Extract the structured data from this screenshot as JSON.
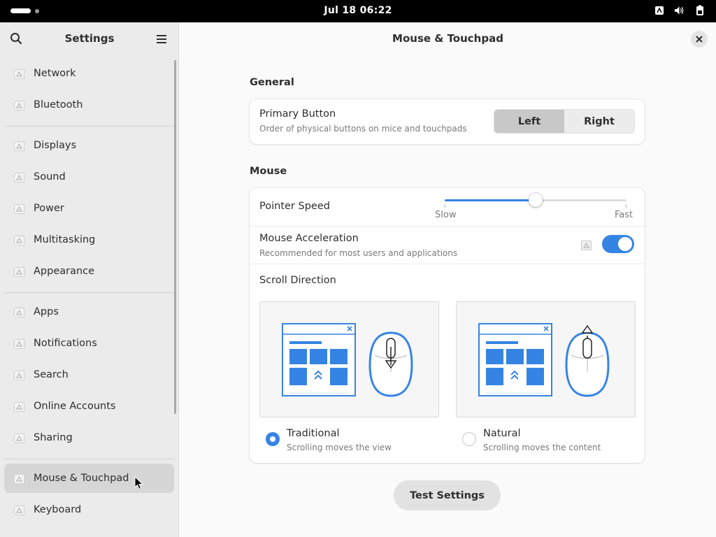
{
  "topbar": {
    "clock": "Jul 18  06:22",
    "tray_icons": [
      "accessibility-icon",
      "volume-icon",
      "battery-icon"
    ]
  },
  "sidebar": {
    "title": "Settings",
    "items": [
      {
        "label": "Network",
        "icon": "network-icon"
      },
      {
        "label": "Bluetooth",
        "icon": "bluetooth-icon"
      },
      {
        "label": "Displays",
        "icon": "display-icon"
      },
      {
        "label": "Sound",
        "icon": "sound-icon"
      },
      {
        "label": "Power",
        "icon": "power-icon"
      },
      {
        "label": "Multitasking",
        "icon": "multitasking-icon"
      },
      {
        "label": "Appearance",
        "icon": "appearance-icon"
      },
      {
        "label": "Apps",
        "icon": "apps-icon"
      },
      {
        "label": "Notifications",
        "icon": "notifications-icon"
      },
      {
        "label": "Search",
        "icon": "search-icon"
      },
      {
        "label": "Online Accounts",
        "icon": "online-accounts-icon"
      },
      {
        "label": "Sharing",
        "icon": "sharing-icon"
      },
      {
        "label": "Mouse & Touchpad",
        "icon": "mouse-icon",
        "active": true
      },
      {
        "label": "Keyboard",
        "icon": "keyboard-icon"
      }
    ]
  },
  "main": {
    "title": "Mouse & Touchpad",
    "general": {
      "heading": "General",
      "primary_button": {
        "title": "Primary Button",
        "subtitle": "Order of physical buttons on mice and touchpads",
        "options": [
          "Left",
          "Right"
        ],
        "selected": "Left"
      }
    },
    "mouse": {
      "heading": "Mouse",
      "pointer_speed": {
        "title": "Pointer Speed",
        "min_label": "Slow",
        "max_label": "Fast",
        "value": 0.5
      },
      "acceleration": {
        "title": "Mouse Acceleration",
        "subtitle": "Recommended for most users and applications",
        "enabled": true
      },
      "scroll_direction": {
        "title": "Scroll Direction",
        "options": [
          {
            "title": "Traditional",
            "subtitle": "Scrolling moves the view",
            "selected": true
          },
          {
            "title": "Natural",
            "subtitle": "Scrolling moves the content",
            "selected": false
          }
        ]
      }
    },
    "test_button": "Test Settings"
  },
  "colors": {
    "accent": "#3584e4",
    "topbar": "#000000",
    "sidebar_bg": "#ebebeb",
    "main_bg": "#fafafa"
  }
}
